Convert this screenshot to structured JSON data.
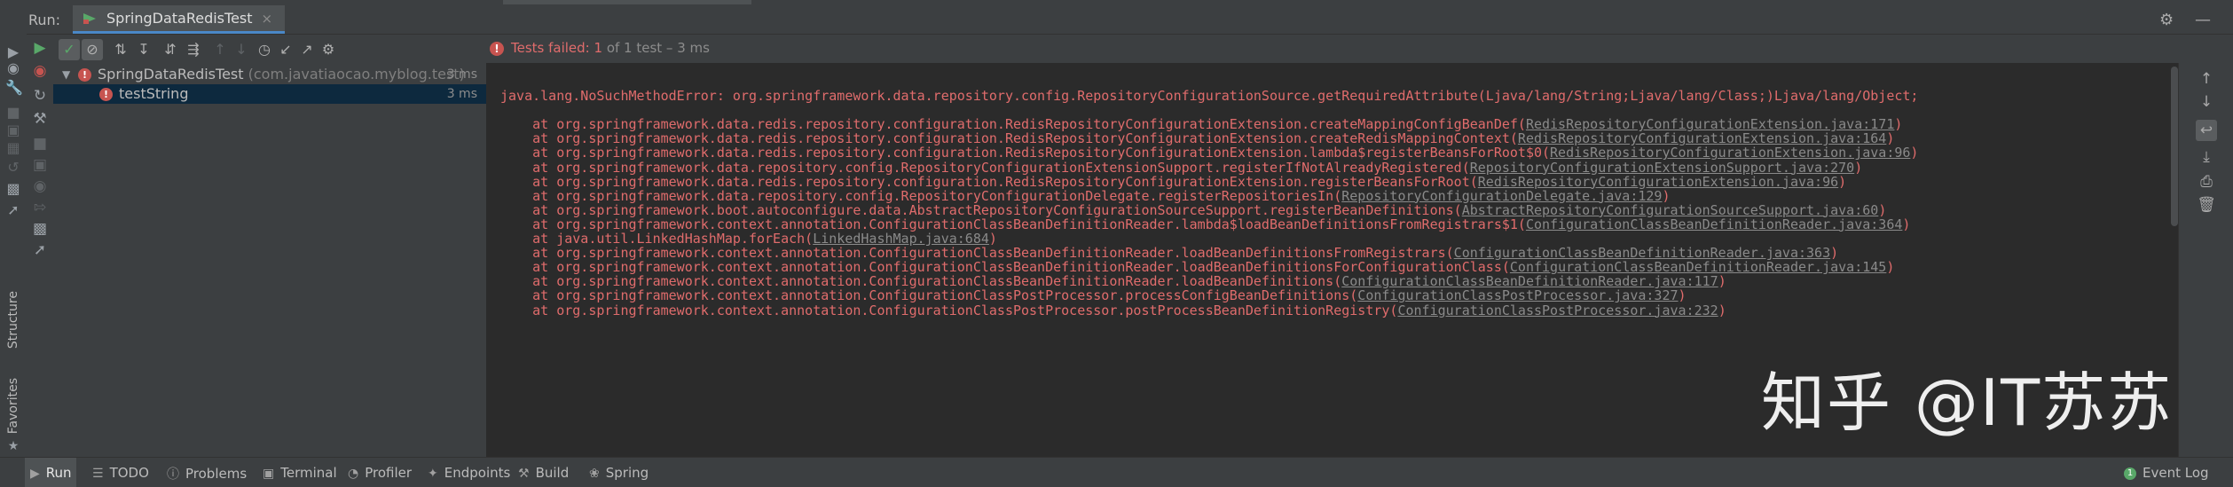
{
  "header": {
    "run_label": "Run:",
    "tab_label": "SpringDataRedisTest",
    "tab_close": "×",
    "settings_icon": "gear-icon",
    "minimize_icon": "minimize-icon"
  },
  "left_stripe": {
    "structure_label": "Structure",
    "favorites_label": "Favorites"
  },
  "status": {
    "fail_text": "Tests failed: 1",
    "rest_text": " of 1 test – 3 ms"
  },
  "tree": {
    "items": [
      {
        "name": "SpringDataRedisTest",
        "pkg": " (com.javatiaocao.myblog.test)",
        "time": "3 ms"
      },
      {
        "name": "testString",
        "pkg": "",
        "time": "3 ms"
      }
    ]
  },
  "console": {
    "lines": [
      {
        "text": "java.lang.NoSuchMethodError: org.springframework.data.repository.config.RepositoryConfigurationSource.getRequiredAttribute(Ljava/lang/String;Ljava/lang/Class;)Ljava/lang/Object;",
        "link": "",
        "tail": ""
      },
      {
        "text": "",
        "link": "",
        "tail": ""
      },
      {
        "text": "    at org.springframework.data.redis.repository.configuration.RedisRepositoryConfigurationExtension.createMappingConfigBeanDef(",
        "link": "RedisRepositoryConfigurationExtension.java:171",
        "tail": ")"
      },
      {
        "text": "    at org.springframework.data.redis.repository.configuration.RedisRepositoryConfigurationExtension.createRedisMappingContext(",
        "link": "RedisRepositoryConfigurationExtension.java:164",
        "tail": ")"
      },
      {
        "text": "    at org.springframework.data.redis.repository.configuration.RedisRepositoryConfigurationExtension.lambda$registerBeansForRoot$0(",
        "link": "RedisRepositoryConfigurationExtension.java:96",
        "tail": ")"
      },
      {
        "text": "    at org.springframework.data.repository.config.RepositoryConfigurationExtensionSupport.registerIfNotAlreadyRegistered(",
        "link": "RepositoryConfigurationExtensionSupport.java:270",
        "tail": ")"
      },
      {
        "text": "    at org.springframework.data.redis.repository.configuration.RedisRepositoryConfigurationExtension.registerBeansForRoot(",
        "link": "RedisRepositoryConfigurationExtension.java:96",
        "tail": ")"
      },
      {
        "text": "    at org.springframework.data.repository.config.RepositoryConfigurationDelegate.registerRepositoriesIn(",
        "link": "RepositoryConfigurationDelegate.java:129",
        "tail": ")"
      },
      {
        "text": "    at org.springframework.boot.autoconfigure.data.AbstractRepositoryConfigurationSourceSupport.registerBeanDefinitions(",
        "link": "AbstractRepositoryConfigurationSourceSupport.java:60",
        "tail": ")"
      },
      {
        "text": "    at org.springframework.context.annotation.ConfigurationClassBeanDefinitionReader.lambda$loadBeanDefinitionsFromRegistrars$1(",
        "link": "ConfigurationClassBeanDefinitionReader.java:364",
        "tail": ")"
      },
      {
        "text": "    at java.util.LinkedHashMap.forEach(",
        "link": "LinkedHashMap.java:684",
        "tail": ")"
      },
      {
        "text": "    at org.springframework.context.annotation.ConfigurationClassBeanDefinitionReader.loadBeanDefinitionsFromRegistrars(",
        "link": "ConfigurationClassBeanDefinitionReader.java:363",
        "tail": ")"
      },
      {
        "text": "    at org.springframework.context.annotation.ConfigurationClassBeanDefinitionReader.loadBeanDefinitionsForConfigurationClass(",
        "link": "ConfigurationClassBeanDefinitionReader.java:145",
        "tail": ")"
      },
      {
        "text": "    at org.springframework.context.annotation.ConfigurationClassBeanDefinitionReader.loadBeanDefinitions(",
        "link": "ConfigurationClassBeanDefinitionReader.java:117",
        "tail": ")"
      },
      {
        "text": "    at org.springframework.context.annotation.ConfigurationClassPostProcessor.processConfigBeanDefinitions(",
        "link": "ConfigurationClassPostProcessor.java:327",
        "tail": ")"
      },
      {
        "text": "    at org.springframework.context.annotation.ConfigurationClassPostProcessor.postProcessBeanDefinitionRegistry(",
        "link": "ConfigurationClassPostProcessor.java:232",
        "tail": ")"
      }
    ]
  },
  "watermark": "知乎 @IT苏苏",
  "bottom_bar": {
    "items": [
      {
        "label": "Run",
        "icon": "play-icon"
      },
      {
        "label": "TODO",
        "icon": "list-icon"
      },
      {
        "label": "Problems",
        "icon": "problems-icon"
      },
      {
        "label": "Terminal",
        "icon": "terminal-icon"
      },
      {
        "label": "Profiler",
        "icon": "profiler-icon"
      },
      {
        "label": "Endpoints",
        "icon": "endpoints-icon"
      },
      {
        "label": "Build",
        "icon": "hammer-icon"
      },
      {
        "label": "Spring",
        "icon": "spring-icon"
      }
    ],
    "event_log": "Event Log",
    "event_badge": "1"
  },
  "colors": {
    "error": "#e06c6c",
    "accent": "#4a88c7",
    "selection": "#0d293e"
  }
}
